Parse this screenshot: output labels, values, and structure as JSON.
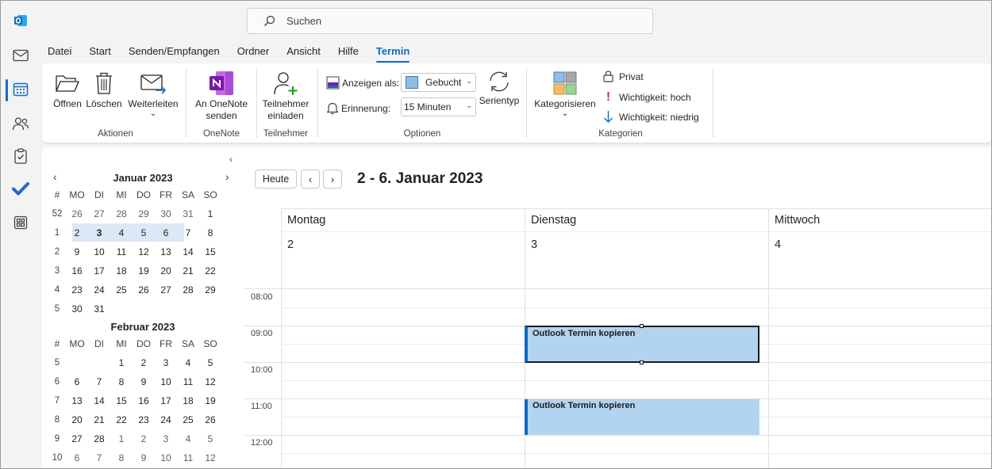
{
  "app": {
    "brand_color": "#0f6cbd"
  },
  "rail": {
    "items": [
      {
        "name": "outlook-logo-icon"
      },
      {
        "name": "mail-icon"
      },
      {
        "name": "calendar-icon"
      },
      {
        "name": "people-icon"
      },
      {
        "name": "tasks-icon"
      },
      {
        "name": "todo-icon"
      },
      {
        "name": "apps-icon"
      }
    ]
  },
  "search": {
    "placeholder": "Suchen"
  },
  "menu": {
    "tabs": [
      {
        "label": "Datei"
      },
      {
        "label": "Start"
      },
      {
        "label": "Senden/Empfangen"
      },
      {
        "label": "Ordner"
      },
      {
        "label": "Ansicht"
      },
      {
        "label": "Hilfe"
      },
      {
        "label": "Termin",
        "active": true
      }
    ]
  },
  "ribbon": {
    "aktionen": {
      "label": "Aktionen",
      "open": "Öffnen",
      "delete": "Löschen",
      "forward": "Weiterleiten",
      "forward_chevron": "⌄"
    },
    "onenote": {
      "label": "OneNote",
      "send_line1": "An OneNote",
      "send_line2": "senden"
    },
    "teilnehmer": {
      "label": "Teilnehmer",
      "invite_line1": "Teilnehmer",
      "invite_line2": "einladen"
    },
    "optionen": {
      "label": "Optionen",
      "show_as_label": "Anzeigen als:",
      "show_as_value": "Gebucht",
      "reminder_label": "Erinnerung:",
      "reminder_value": "15 Minuten",
      "recurrence": "Serientyp"
    },
    "kategorien": {
      "label": "Kategorien",
      "categorize": "Kategorisieren",
      "categorize_chevron": "⌄",
      "private": "Privat",
      "importance_high": "Wichtigkeit: hoch",
      "importance_low": "Wichtigkeit: niedrig"
    }
  },
  "mini_calendar": {
    "collapse_glyph": "‹",
    "prev_glyph": "‹",
    "next_glyph": "›",
    "weekday_header": [
      "#",
      "MO",
      "DI",
      "MI",
      "DO",
      "FR",
      "SA",
      "SO"
    ],
    "months": [
      {
        "title": "Januar 2023",
        "weeks": [
          {
            "wk": "52",
            "days": [
              "26",
              "27",
              "28",
              "29",
              "30",
              "31",
              "1"
            ],
            "dim": [
              true,
              true,
              true,
              true,
              true,
              true,
              false
            ]
          },
          {
            "wk": "1",
            "days": [
              "2",
              "3",
              "4",
              "5",
              "6",
              "7",
              "8"
            ],
            "dim": [
              false,
              false,
              false,
              false,
              false,
              false,
              false
            ]
          },
          {
            "wk": "2",
            "days": [
              "9",
              "10",
              "11",
              "12",
              "13",
              "14",
              "15"
            ],
            "dim": [
              false,
              false,
              false,
              false,
              false,
              false,
              false
            ]
          },
          {
            "wk": "3",
            "days": [
              "16",
              "17",
              "18",
              "19",
              "20",
              "21",
              "22"
            ],
            "dim": [
              false,
              false,
              false,
              false,
              false,
              false,
              false
            ]
          },
          {
            "wk": "4",
            "days": [
              "23",
              "24",
              "25",
              "26",
              "27",
              "28",
              "29"
            ],
            "dim": [
              false,
              false,
              false,
              false,
              false,
              false,
              false
            ]
          },
          {
            "wk": "5",
            "days": [
              "30",
              "31",
              "",
              "",
              "",
              "",
              ""
            ],
            "dim": [
              false,
              false,
              false,
              false,
              false,
              false,
              false
            ]
          }
        ]
      },
      {
        "title": "Februar 2023",
        "weeks": [
          {
            "wk": "5",
            "days": [
              "",
              "",
              "1",
              "2",
              "3",
              "4",
              "5"
            ],
            "dim": [
              false,
              false,
              false,
              false,
              false,
              false,
              false
            ]
          },
          {
            "wk": "6",
            "days": [
              "6",
              "7",
              "8",
              "9",
              "10",
              "11",
              "12"
            ],
            "dim": [
              false,
              false,
              false,
              false,
              false,
              false,
              false
            ]
          },
          {
            "wk": "7",
            "days": [
              "13",
              "14",
              "15",
              "16",
              "17",
              "18",
              "19"
            ],
            "dim": [
              false,
              false,
              false,
              false,
              false,
              false,
              false
            ]
          },
          {
            "wk": "8",
            "days": [
              "20",
              "21",
              "22",
              "23",
              "24",
              "25",
              "26"
            ],
            "dim": [
              false,
              false,
              false,
              false,
              false,
              false,
              false
            ]
          },
          {
            "wk": "9",
            "days": [
              "27",
              "28",
              "1",
              "2",
              "3",
              "4",
              "5"
            ],
            "dim": [
              false,
              false,
              true,
              true,
              true,
              true,
              true
            ]
          },
          {
            "wk": "10",
            "days": [
              "6",
              "7",
              "8",
              "9",
              "10",
              "11",
              "12"
            ],
            "dim": [
              true,
              true,
              true,
              true,
              true,
              true,
              true
            ]
          }
        ]
      }
    ],
    "today": "3"
  },
  "toolbar": {
    "today_label": "Heute",
    "prev_glyph": "‹",
    "next_glyph": "›",
    "range_title": "2 - 6. Januar 2023"
  },
  "days": [
    {
      "name": "Montag",
      "number": "2"
    },
    {
      "name": "Dienstag",
      "number": "3"
    },
    {
      "name": "Mittwoch",
      "number": "4"
    }
  ],
  "times": [
    "08:00",
    "09:00",
    "10:00",
    "11:00",
    "12:00"
  ],
  "events": [
    {
      "title": "Outlook Termin kopieren",
      "day": "Dienstag",
      "start": "09:00",
      "end": "10:00",
      "selected": true
    },
    {
      "title": "Outlook Termin kopieren",
      "day": "Dienstag",
      "start": "11:00",
      "end": "12:00",
      "selected": false
    }
  ]
}
